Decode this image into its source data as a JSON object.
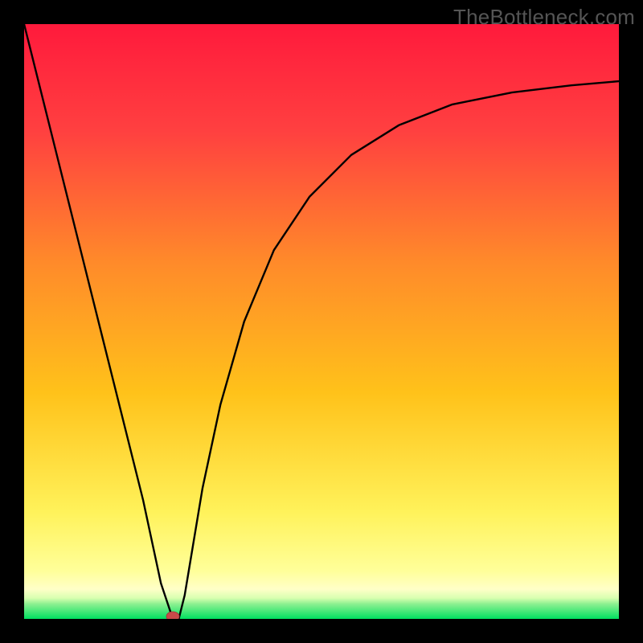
{
  "watermark": "TheBottleneck.com",
  "chart_data": {
    "type": "line",
    "title": "",
    "xlabel": "",
    "ylabel": "",
    "xlim": [
      0,
      100
    ],
    "ylim": [
      0,
      100
    ],
    "grid": false,
    "background_gradient": {
      "top_color": "#ff1a3c",
      "mid_color": "#ffcc00",
      "bottom_band_color": "#00e060",
      "bottom_band_height_pct": 3
    },
    "optimum_marker": {
      "x": 25,
      "y": 0,
      "color": "#c94a4a",
      "radius_px": 8
    },
    "series": [
      {
        "name": "curve",
        "x": [
          0,
          5,
          10,
          15,
          20,
          23,
          25,
          26,
          27,
          28,
          30,
          33,
          37,
          42,
          48,
          55,
          63,
          72,
          82,
          92,
          100
        ],
        "y": [
          100,
          80,
          60,
          40,
          20,
          6,
          0,
          0,
          4,
          10,
          22,
          36,
          50,
          62,
          71,
          78,
          83,
          86.5,
          88.5,
          89.7,
          90.4
        ]
      }
    ]
  }
}
